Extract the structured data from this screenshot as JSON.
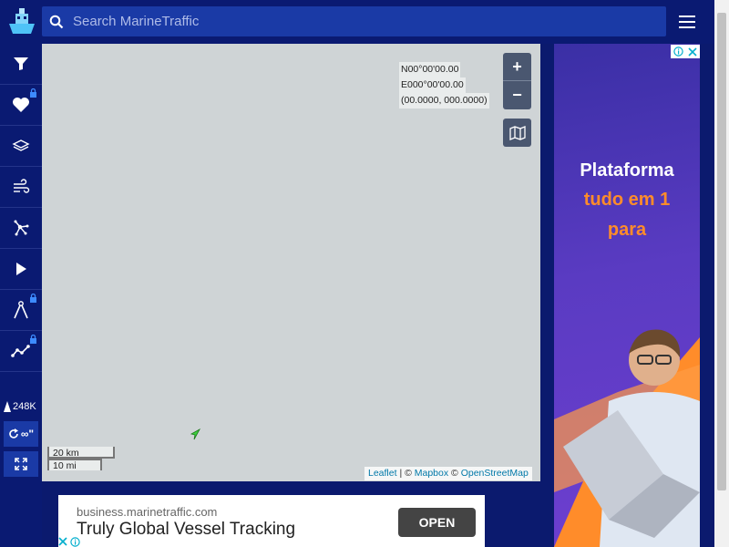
{
  "search": {
    "placeholder": "Search MarineTraffic"
  },
  "sidebar": {
    "items": [
      {
        "name": "filter",
        "locked": false
      },
      {
        "name": "favorites",
        "locked": true
      },
      {
        "name": "layers",
        "locked": false
      },
      {
        "name": "weather",
        "locked": false
      },
      {
        "name": "routes",
        "locked": false
      },
      {
        "name": "playback",
        "locked": true
      },
      {
        "name": "measure",
        "locked": true
      },
      {
        "name": "analytics",
        "locked": true
      }
    ],
    "vessel_count": "248K",
    "refresh_label": "∞\""
  },
  "map": {
    "coords_lat": "N00°00'00.00",
    "coords_lon": "E000°00'00.00",
    "coords_dec": "(00.0000, 000.0000)",
    "zoom_in": "+",
    "zoom_out": "−",
    "scale_km": "20 km",
    "scale_mi": "10 mi",
    "attribution": {
      "leaflet": "Leaflet",
      "sep": " | © ",
      "mapbox": "Mapbox",
      "sep2": " © ",
      "osm": "OpenStreetMap"
    }
  },
  "ad_right": {
    "line1": "Plataforma",
    "line2": "tudo em 1",
    "line3": "para"
  },
  "ad_bottom": {
    "domain": "business.marinetraffic.com",
    "headline": "Truly Global Vessel Tracking",
    "cta": "OPEN"
  },
  "colors": {
    "nav": "#0a1a72",
    "search": "#1a3aa6",
    "map": "#cfd4d6",
    "accent_orange": "#ff8c2a"
  }
}
